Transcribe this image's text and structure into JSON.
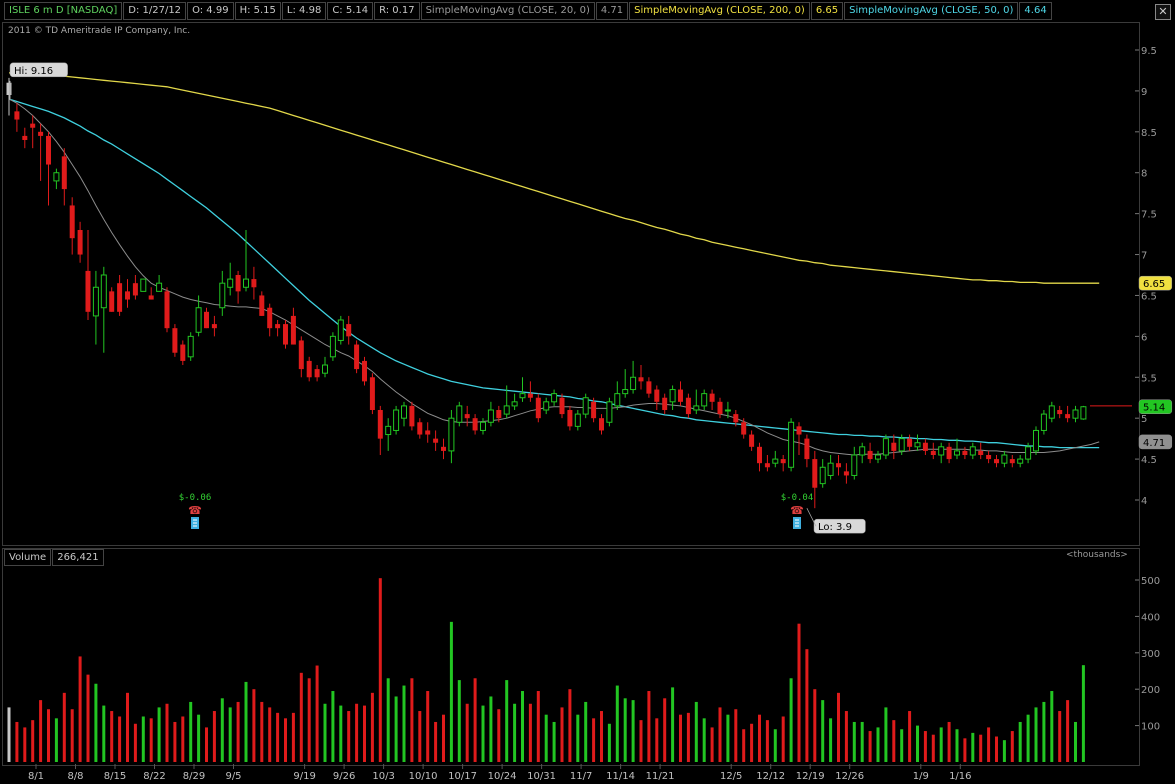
{
  "header": {
    "symbol": "ISLE 6 m D [NASDAQ]",
    "date": "D: 1/27/12",
    "open": "O: 4.99",
    "high": "H: 5.15",
    "low": "L: 4.98",
    "close": "C: 5.14",
    "range": "R: 0.17",
    "sma20_label": "SimpleMovingAvg (CLOSE, 20, 0)",
    "sma20_value": "4.71",
    "sma200_label": "SimpleMovingAvg (CLOSE, 200, 0)",
    "sma200_value": "6.65",
    "sma50_label": "SimpleMovingAvg (CLOSE, 50, 0)",
    "sma50_value": "4.64"
  },
  "copyright": "2011 © TD Ameritrade IP Company, Inc.",
  "volume_header": {
    "label": "Volume",
    "value": "266,421",
    "unit": "<thousands>"
  },
  "colors": {
    "up": "#22c622",
    "down": "#e01b1b",
    "sma200": "#e2d84a",
    "sma50": "#3fd0de",
    "sma20": "#8c8c8c"
  },
  "chart_data": {
    "type": "candlestick",
    "price_axis": {
      "ticks": [
        9.5,
        9,
        8.5,
        8,
        7.5,
        7,
        6.5,
        6,
        5.5,
        5,
        4.5,
        4
      ],
      "range": [
        3.75,
        9.75
      ]
    },
    "volume_axis": {
      "ticks": [
        500,
        400,
        300,
        200,
        100
      ],
      "range": [
        0,
        540
      ]
    },
    "x_labels": [
      {
        "label": "8/1",
        "i": 0
      },
      {
        "label": "8/8",
        "i": 5
      },
      {
        "label": "8/15",
        "i": 10
      },
      {
        "label": "8/22",
        "i": 15
      },
      {
        "label": "8/29",
        "i": 20
      },
      {
        "label": "9/5",
        "i": 25
      },
      {
        "label": "9/19",
        "i": 34
      },
      {
        "label": "9/26",
        "i": 39
      },
      {
        "label": "10/3",
        "i": 44
      },
      {
        "label": "10/10",
        "i": 49
      },
      {
        "label": "10/17",
        "i": 54
      },
      {
        "label": "10/24",
        "i": 59
      },
      {
        "label": "10/31",
        "i": 64
      },
      {
        "label": "11/7",
        "i": 69
      },
      {
        "label": "11/14",
        "i": 74
      },
      {
        "label": "11/21",
        "i": 79
      },
      {
        "label": "12/5",
        "i": 88
      },
      {
        "label": "12/12",
        "i": 93
      },
      {
        "label": "12/19",
        "i": 98
      },
      {
        "label": "12/26",
        "i": 103
      },
      {
        "label": "1/9",
        "i": 112
      },
      {
        "label": "1/16",
        "i": 117
      }
    ],
    "annotations": {
      "high": "Hi: 9.16",
      "low": "Lo: 3.9",
      "dividend_1": "$-0.06",
      "dividend_2": "$-0.04",
      "sma200_last": "6.65",
      "close_last": "5.14",
      "sma20_last": "4.71"
    },
    "candles": [
      [
        9.1,
        8.95,
        9.16,
        8.7,
        150
      ],
      [
        8.75,
        8.65,
        8.85,
        8.5,
        110
      ],
      [
        8.45,
        8.4,
        8.55,
        8.3,
        95
      ],
      [
        8.6,
        8.55,
        8.7,
        8.3,
        115
      ],
      [
        8.5,
        8.45,
        8.6,
        7.9,
        170
      ],
      [
        8.45,
        8.1,
        8.5,
        7.6,
        145
      ],
      [
        7.9,
        8.0,
        8.05,
        7.8,
        120
      ],
      [
        8.2,
        7.8,
        8.3,
        7.6,
        190
      ],
      [
        7.6,
        7.2,
        7.7,
        7.0,
        145
      ],
      [
        7.3,
        7.0,
        7.4,
        6.9,
        290
      ],
      [
        6.8,
        6.3,
        7.3,
        6.2,
        240
      ],
      [
        6.25,
        6.6,
        6.8,
        5.9,
        215
      ],
      [
        6.35,
        6.75,
        6.85,
        5.8,
        155
      ],
      [
        6.55,
        6.3,
        6.6,
        6.3,
        140
      ],
      [
        6.65,
        6.3,
        6.75,
        6.25,
        125
      ],
      [
        6.55,
        6.45,
        6.7,
        6.35,
        190
      ],
      [
        6.65,
        6.5,
        6.75,
        6.45,
        105
      ],
      [
        6.55,
        6.7,
        6.7,
        6.55,
        125
      ],
      [
        6.5,
        6.45,
        6.6,
        6.45,
        120
      ],
      [
        6.55,
        6.65,
        6.75,
        6.55,
        150
      ],
      [
        6.55,
        6.1,
        6.6,
        6.05,
        160
      ],
      [
        6.1,
        5.8,
        6.15,
        5.75,
        110
      ],
      [
        5.9,
        5.7,
        5.95,
        5.65,
        125
      ],
      [
        5.75,
        6.0,
        6.05,
        5.7,
        165
      ],
      [
        6.05,
        6.35,
        6.5,
        6.0,
        130
      ],
      [
        6.3,
        6.1,
        6.35,
        6.1,
        95
      ],
      [
        6.15,
        6.1,
        6.25,
        6.0,
        140
      ],
      [
        6.35,
        6.65,
        6.8,
        6.25,
        175
      ],
      [
        6.6,
        6.7,
        6.9,
        6.5,
        150
      ],
      [
        6.75,
        6.55,
        6.8,
        6.4,
        165
      ],
      [
        6.6,
        6.7,
        7.3,
        6.55,
        220
      ],
      [
        6.7,
        6.6,
        6.85,
        6.45,
        200
      ],
      [
        6.5,
        6.25,
        6.55,
        6.25,
        165
      ],
      [
        6.35,
        6.1,
        6.4,
        6.0,
        150
      ],
      [
        6.15,
        6.1,
        6.2,
        6.0,
        135
      ],
      [
        6.15,
        5.9,
        6.2,
        5.85,
        120
      ],
      [
        6.25,
        5.9,
        6.35,
        5.9,
        135
      ],
      [
        5.95,
        5.6,
        6.0,
        5.5,
        245
      ],
      [
        5.7,
        5.5,
        5.75,
        5.45,
        230
      ],
      [
        5.6,
        5.5,
        5.65,
        5.45,
        265
      ],
      [
        5.55,
        5.65,
        5.75,
        5.5,
        160
      ],
      [
        5.75,
        6.0,
        6.05,
        5.7,
        195
      ],
      [
        5.95,
        6.2,
        6.25,
        5.9,
        155
      ],
      [
        6.15,
        6.0,
        6.25,
        5.9,
        140
      ],
      [
        5.9,
        5.6,
        5.95,
        5.55,
        160
      ],
      [
        5.7,
        5.45,
        5.75,
        5.4,
        155
      ],
      [
        5.5,
        5.1,
        5.55,
        5.05,
        190
      ],
      [
        5.1,
        4.75,
        5.15,
        4.55,
        505
      ],
      [
        4.8,
        4.9,
        5.0,
        4.6,
        230
      ],
      [
        4.85,
        5.1,
        5.15,
        4.8,
        180
      ],
      [
        5.0,
        5.15,
        5.2,
        4.9,
        210
      ],
      [
        5.15,
        4.9,
        5.2,
        4.85,
        230
      ],
      [
        4.95,
        4.8,
        5.0,
        4.75,
        140
      ],
      [
        4.85,
        4.8,
        4.95,
        4.7,
        195
      ],
      [
        4.75,
        4.7,
        4.85,
        4.6,
        110
      ],
      [
        4.65,
        4.6,
        4.75,
        4.5,
        130
      ],
      [
        4.6,
        5.0,
        5.1,
        4.45,
        385
      ],
      [
        4.95,
        5.15,
        5.2,
        4.9,
        225
      ],
      [
        5.05,
        5.0,
        5.15,
        4.9,
        160
      ],
      [
        5.0,
        4.85,
        5.05,
        4.8,
        230
      ],
      [
        4.85,
        4.95,
        5.0,
        4.8,
        155
      ],
      [
        4.95,
        5.1,
        5.2,
        4.9,
        180
      ],
      [
        5.1,
        5.0,
        5.15,
        4.95,
        145
      ],
      [
        5.05,
        5.15,
        5.4,
        5.0,
        225
      ],
      [
        5.15,
        5.2,
        5.3,
        5.1,
        160
      ],
      [
        5.25,
        5.3,
        5.5,
        5.2,
        195
      ],
      [
        5.3,
        5.25,
        5.45,
        5.2,
        160
      ],
      [
        5.25,
        5.0,
        5.3,
        4.95,
        195
      ],
      [
        5.1,
        5.2,
        5.25,
        5.05,
        130
      ],
      [
        5.2,
        5.3,
        5.35,
        5.15,
        110
      ],
      [
        5.25,
        5.05,
        5.3,
        5.0,
        150
      ],
      [
        5.1,
        4.9,
        5.15,
        4.85,
        200
      ],
      [
        4.9,
        5.05,
        5.1,
        4.85,
        130
      ],
      [
        5.05,
        5.25,
        5.3,
        5.0,
        165
      ],
      [
        5.2,
        5.0,
        5.25,
        4.95,
        120
      ],
      [
        5.0,
        4.85,
        5.05,
        4.8,
        140
      ],
      [
        4.95,
        5.2,
        5.25,
        4.9,
        105
      ],
      [
        5.15,
        5.3,
        5.45,
        5.1,
        210
      ],
      [
        5.3,
        5.35,
        5.6,
        5.25,
        175
      ],
      [
        5.35,
        5.5,
        5.7,
        5.3,
        170
      ],
      [
        5.5,
        5.45,
        5.65,
        5.35,
        115
      ],
      [
        5.45,
        5.3,
        5.5,
        5.25,
        195
      ],
      [
        5.35,
        5.2,
        5.4,
        5.1,
        120
      ],
      [
        5.25,
        5.1,
        5.3,
        5.05,
        175
      ],
      [
        5.2,
        5.35,
        5.4,
        5.1,
        205
      ],
      [
        5.35,
        5.2,
        5.45,
        5.15,
        130
      ],
      [
        5.25,
        5.05,
        5.3,
        5.0,
        135
      ],
      [
        5.1,
        5.15,
        5.35,
        5.05,
        165
      ],
      [
        5.15,
        5.3,
        5.35,
        5.1,
        120
      ],
      [
        5.3,
        5.2,
        5.35,
        5.1,
        95
      ],
      [
        5.2,
        5.05,
        5.25,
        5.0,
        150
      ],
      [
        5.1,
        5.1,
        5.2,
        5.0,
        130
      ],
      [
        5.05,
        4.95,
        5.1,
        4.9,
        145
      ],
      [
        4.95,
        4.8,
        5.0,
        4.75,
        90
      ],
      [
        4.8,
        4.65,
        4.85,
        4.6,
        105
      ],
      [
        4.65,
        4.45,
        4.7,
        4.35,
        130
      ],
      [
        4.45,
        4.4,
        4.55,
        4.35,
        115
      ],
      [
        4.45,
        4.5,
        4.6,
        4.4,
        90
      ],
      [
        4.5,
        4.45,
        4.55,
        4.35,
        125
      ],
      [
        4.4,
        4.95,
        5.0,
        4.35,
        230
      ],
      [
        4.9,
        4.8,
        4.95,
        4.55,
        380
      ],
      [
        4.75,
        4.5,
        4.8,
        4.4,
        310
      ],
      [
        4.5,
        4.15,
        4.6,
        3.9,
        200
      ],
      [
        4.2,
        4.4,
        4.5,
        4.15,
        170
      ],
      [
        4.3,
        4.45,
        4.55,
        4.25,
        120
      ],
      [
        4.45,
        4.4,
        4.55,
        4.3,
        190
      ],
      [
        4.35,
        4.3,
        4.45,
        4.2,
        140
      ],
      [
        4.3,
        4.55,
        4.65,
        4.25,
        110
      ],
      [
        4.55,
        4.65,
        4.7,
        4.45,
        110
      ],
      [
        4.6,
        4.5,
        4.7,
        4.45,
        85
      ],
      [
        4.5,
        4.55,
        4.6,
        4.45,
        95
      ],
      [
        4.55,
        4.75,
        4.8,
        4.5,
        150
      ],
      [
        4.7,
        4.6,
        4.8,
        4.5,
        115
      ],
      [
        4.6,
        4.75,
        4.8,
        4.55,
        90
      ],
      [
        4.75,
        4.65,
        4.8,
        4.6,
        140
      ],
      [
        4.65,
        4.7,
        4.8,
        4.6,
        100
      ],
      [
        4.7,
        4.6,
        4.75,
        4.55,
        85
      ],
      [
        4.6,
        4.55,
        4.7,
        4.5,
        75
      ],
      [
        4.55,
        4.65,
        4.7,
        4.45,
        95
      ],
      [
        4.65,
        4.5,
        4.7,
        4.45,
        110
      ],
      [
        4.55,
        4.6,
        4.75,
        4.5,
        90
      ],
      [
        4.6,
        4.55,
        4.65,
        4.5,
        65
      ],
      [
        4.55,
        4.65,
        4.7,
        4.5,
        80
      ],
      [
        4.6,
        4.55,
        4.7,
        4.5,
        75
      ],
      [
        4.55,
        4.5,
        4.6,
        4.45,
        95
      ],
      [
        4.5,
        4.45,
        4.55,
        4.4,
        70
      ],
      [
        4.45,
        4.55,
        4.6,
        4.4,
        60
      ],
      [
        4.5,
        4.45,
        4.55,
        4.4,
        85
      ],
      [
        4.45,
        4.5,
        4.55,
        4.4,
        110
      ],
      [
        4.5,
        4.65,
        4.7,
        4.45,
        130
      ],
      [
        4.6,
        4.85,
        4.9,
        4.55,
        150
      ],
      [
        4.85,
        5.05,
        5.1,
        4.8,
        165
      ],
      [
        5.0,
        5.15,
        5.2,
        4.95,
        195
      ],
      [
        5.1,
        5.05,
        5.15,
        5.0,
        140
      ],
      [
        5.05,
        5.0,
        5.15,
        4.95,
        170
      ],
      [
        5.0,
        5.1,
        5.15,
        4.95,
        110
      ],
      [
        4.99,
        5.14,
        5.15,
        4.98,
        266
      ]
    ],
    "sma20": [
      8.9,
      8.85,
      8.78,
      8.7,
      8.6,
      8.5,
      8.38,
      8.25,
      8.1,
      7.95,
      7.78,
      7.6,
      7.43,
      7.27,
      7.12,
      6.98,
      6.85,
      6.74,
      6.65,
      6.6,
      6.56,
      6.52,
      6.48,
      6.45,
      6.43,
      6.41,
      6.39,
      6.38,
      6.37,
      6.36,
      6.36,
      6.35,
      6.34,
      6.3,
      6.25,
      6.2,
      6.14,
      6.08,
      6.02,
      5.96,
      5.9,
      5.85,
      5.8,
      5.76,
      5.7,
      5.64,
      5.57,
      5.48,
      5.4,
      5.32,
      5.25,
      5.18,
      5.12,
      5.06,
      5.02,
      4.98,
      4.96,
      4.95,
      4.95,
      4.95,
      4.96,
      4.97,
      4.98,
      5.0,
      5.03,
      5.06,
      5.09,
      5.11,
      5.13,
      5.14,
      5.14,
      5.14,
      5.13,
      5.13,
      5.12,
      5.12,
      5.12,
      5.13,
      5.14,
      5.16,
      5.17,
      5.18,
      5.18,
      5.17,
      5.16,
      5.15,
      5.13,
      5.11,
      5.09,
      5.07,
      5.05,
      5.03,
      5.0,
      4.96,
      4.92,
      4.87,
      4.82,
      4.78,
      4.74,
      4.72,
      4.7,
      4.67,
      4.63,
      4.6,
      4.58,
      4.57,
      4.56,
      4.55,
      4.56,
      4.56,
      4.56,
      4.57,
      4.58,
      4.59,
      4.6,
      4.61,
      4.62,
      4.62,
      4.62,
      4.62,
      4.62,
      4.62,
      4.61,
      4.61,
      4.6,
      4.6,
      4.59,
      4.58,
      4.58,
      4.58,
      4.58,
      4.58,
      4.59,
      4.6,
      4.62,
      4.64,
      4.66,
      4.68,
      4.71
    ],
    "sma50": [
      8.9,
      8.87,
      8.84,
      8.81,
      8.78,
      8.75,
      8.71,
      8.67,
      8.62,
      8.57,
      8.51,
      8.46,
      8.4,
      8.35,
      8.29,
      8.23,
      8.17,
      8.11,
      8.05,
      7.99,
      7.92,
      7.85,
      7.78,
      7.71,
      7.64,
      7.57,
      7.49,
      7.41,
      7.33,
      7.25,
      7.16,
      7.07,
      6.98,
      6.89,
      6.8,
      6.71,
      6.62,
      6.53,
      6.44,
      6.36,
      6.28,
      6.2,
      6.12,
      6.05,
      5.98,
      5.92,
      5.86,
      5.8,
      5.75,
      5.7,
      5.66,
      5.62,
      5.58,
      5.54,
      5.51,
      5.48,
      5.45,
      5.43,
      5.41,
      5.39,
      5.37,
      5.36,
      5.35,
      5.34,
      5.33,
      5.32,
      5.31,
      5.3,
      5.29,
      5.28,
      5.27,
      5.26,
      5.24,
      5.23,
      5.21,
      5.2,
      5.18,
      5.16,
      5.14,
      5.12,
      5.1,
      5.08,
      5.06,
      5.04,
      5.03,
      5.01,
      5.0,
      4.98,
      4.97,
      4.96,
      4.95,
      4.94,
      4.93,
      4.92,
      4.91,
      4.9,
      4.89,
      4.88,
      4.87,
      4.86,
      4.85,
      4.84,
      4.83,
      4.82,
      4.81,
      4.8,
      4.8,
      4.79,
      4.79,
      4.78,
      4.78,
      4.77,
      4.77,
      4.76,
      4.76,
      4.75,
      4.75,
      4.74,
      4.74,
      4.73,
      4.73,
      4.72,
      4.72,
      4.71,
      4.7,
      4.7,
      4.69,
      4.68,
      4.67,
      4.66,
      4.66,
      4.65,
      4.65,
      4.64,
      4.64,
      4.64,
      4.64,
      4.64,
      4.64
    ],
    "sma200": [
      9.22,
      9.22,
      9.21,
      9.21,
      9.2,
      9.2,
      9.19,
      9.18,
      9.17,
      9.16,
      9.15,
      9.14,
      9.13,
      9.12,
      9.11,
      9.1,
      9.09,
      9.08,
      9.07,
      9.06,
      9.05,
      9.03,
      9.01,
      8.99,
      8.97,
      8.95,
      8.93,
      8.91,
      8.89,
      8.87,
      8.85,
      8.83,
      8.81,
      8.79,
      8.76,
      8.73,
      8.7,
      8.67,
      8.64,
      8.61,
      8.58,
      8.55,
      8.52,
      8.49,
      8.46,
      8.43,
      8.4,
      8.37,
      8.34,
      8.31,
      8.28,
      8.25,
      8.22,
      8.19,
      8.16,
      8.13,
      8.1,
      8.07,
      8.04,
      8.01,
      7.98,
      7.95,
      7.92,
      7.89,
      7.86,
      7.83,
      7.8,
      7.77,
      7.74,
      7.71,
      7.68,
      7.65,
      7.62,
      7.59,
      7.56,
      7.53,
      7.5,
      7.47,
      7.44,
      7.42,
      7.39,
      7.36,
      7.33,
      7.31,
      7.28,
      7.25,
      7.23,
      7.2,
      7.18,
      7.15,
      7.13,
      7.11,
      7.09,
      7.07,
      7.05,
      7.03,
      7.01,
      6.99,
      6.97,
      6.95,
      6.93,
      6.92,
      6.9,
      6.89,
      6.87,
      6.86,
      6.85,
      6.84,
      6.83,
      6.82,
      6.81,
      6.8,
      6.79,
      6.78,
      6.77,
      6.76,
      6.75,
      6.74,
      6.73,
      6.72,
      6.71,
      6.7,
      6.69,
      6.69,
      6.68,
      6.68,
      6.67,
      6.67,
      6.66,
      6.66,
      6.66,
      6.65,
      6.65,
      6.65,
      6.65,
      6.65,
      6.65,
      6.65,
      6.65
    ]
  }
}
